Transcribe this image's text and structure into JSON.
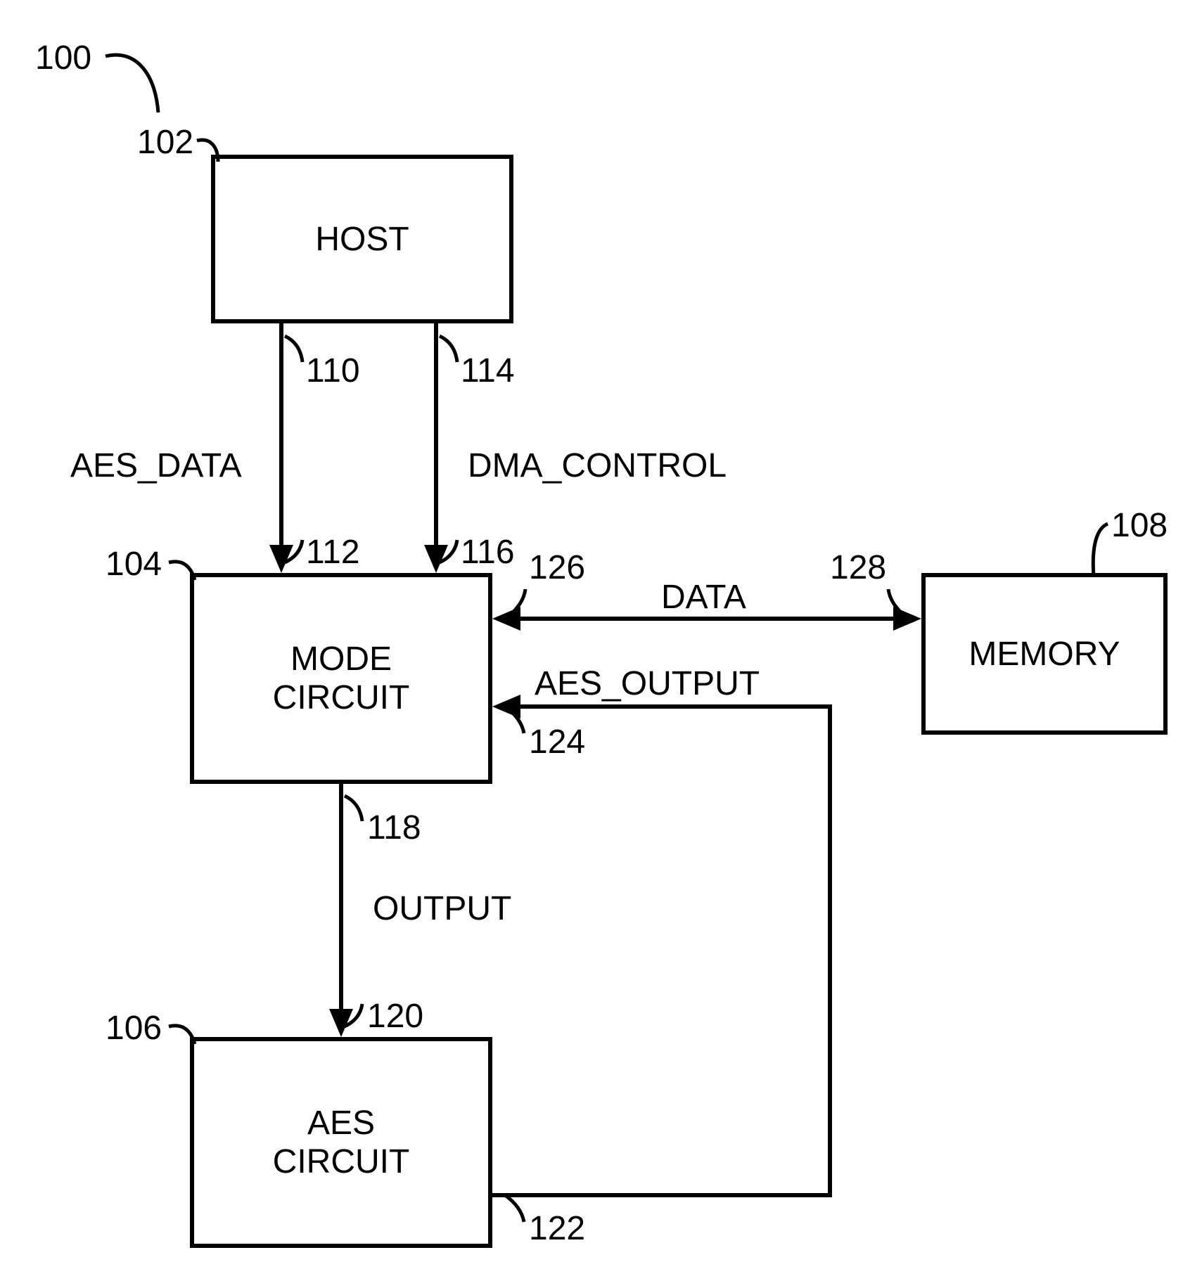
{
  "figure_ref": "100",
  "blocks": {
    "host": {
      "label": "HOST",
      "ref": "102"
    },
    "mode_circuit": {
      "label": "MODE\nCIRCUIT",
      "ref": "104"
    },
    "aes_circuit": {
      "label": "AES\nCIRCUIT",
      "ref": "106"
    },
    "memory": {
      "label": "MEMORY",
      "ref": "108"
    }
  },
  "signals": {
    "aes_data": {
      "label": "AES_DATA",
      "src_ref": "110",
      "dst_ref": "112"
    },
    "dma_control": {
      "label": "DMA_CONTROL",
      "src_ref": "114",
      "dst_ref": "116"
    },
    "output": {
      "label": "OUTPUT",
      "src_ref": "118",
      "dst_ref": "120"
    },
    "aes_output": {
      "label": "AES_OUTPUT",
      "src_ref": "122",
      "dst_ref": "124"
    },
    "data": {
      "label": "DATA",
      "src_ref": "126",
      "dst_ref": "128"
    }
  }
}
